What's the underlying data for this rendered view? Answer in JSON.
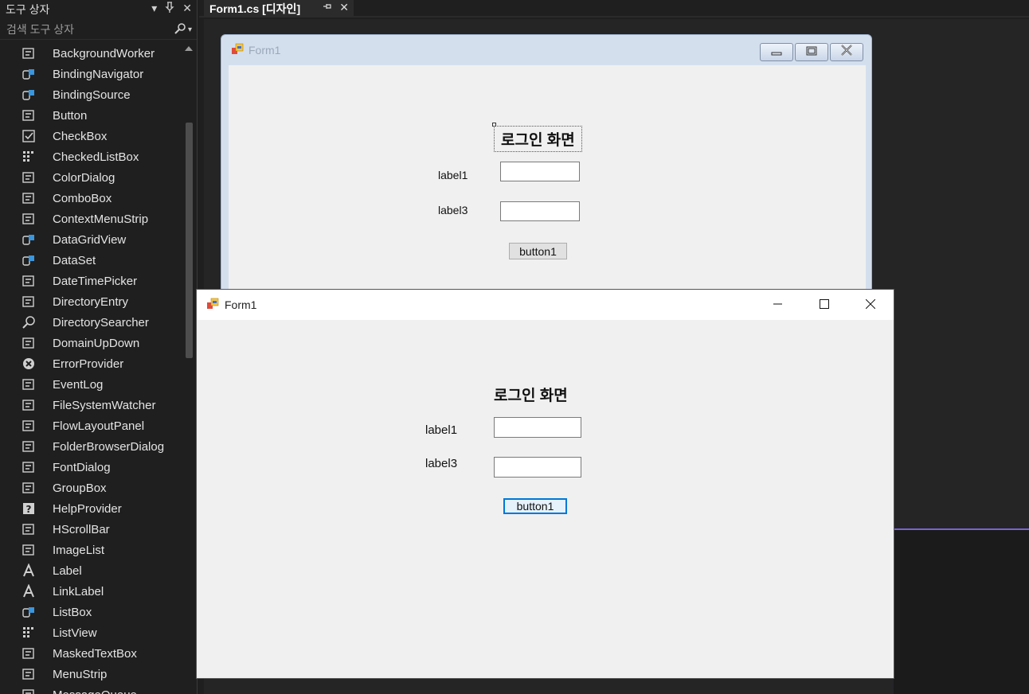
{
  "toolbox": {
    "title": "도구 상자",
    "search_placeholder": "검색 도구 상자",
    "items": [
      {
        "label": "BackgroundWorker",
        "icon": "background-worker-icon"
      },
      {
        "label": "BindingNavigator",
        "icon": "binding-navigator-icon"
      },
      {
        "label": "BindingSource",
        "icon": "binding-source-icon"
      },
      {
        "label": "Button",
        "icon": "button-icon"
      },
      {
        "label": "CheckBox",
        "icon": "checkbox-icon"
      },
      {
        "label": "CheckedListBox",
        "icon": "checked-listbox-icon"
      },
      {
        "label": "ColorDialog",
        "icon": "color-dialog-icon"
      },
      {
        "label": "ComboBox",
        "icon": "combobox-icon"
      },
      {
        "label": "ContextMenuStrip",
        "icon": "context-menu-icon"
      },
      {
        "label": "DataGridView",
        "icon": "datagrid-icon"
      },
      {
        "label": "DataSet",
        "icon": "dataset-icon"
      },
      {
        "label": "DateTimePicker",
        "icon": "datetime-picker-icon"
      },
      {
        "label": "DirectoryEntry",
        "icon": "directory-entry-icon"
      },
      {
        "label": "DirectorySearcher",
        "icon": "directory-searcher-icon"
      },
      {
        "label": "DomainUpDown",
        "icon": "domain-updown-icon"
      },
      {
        "label": "ErrorProvider",
        "icon": "error-provider-icon"
      },
      {
        "label": "EventLog",
        "icon": "eventlog-icon"
      },
      {
        "label": "FileSystemWatcher",
        "icon": "filesystem-watcher-icon"
      },
      {
        "label": "FlowLayoutPanel",
        "icon": "flow-layout-icon"
      },
      {
        "label": "FolderBrowserDialog",
        "icon": "folder-browser-icon"
      },
      {
        "label": "FontDialog",
        "icon": "font-dialog-icon"
      },
      {
        "label": "GroupBox",
        "icon": "groupbox-icon"
      },
      {
        "label": "HelpProvider",
        "icon": "help-provider-icon"
      },
      {
        "label": "HScrollBar",
        "icon": "hscrollbar-icon"
      },
      {
        "label": "ImageList",
        "icon": "imagelist-icon"
      },
      {
        "label": "Label",
        "icon": "label-icon"
      },
      {
        "label": "LinkLabel",
        "icon": "linklabel-icon"
      },
      {
        "label": "ListBox",
        "icon": "listbox-icon"
      },
      {
        "label": "ListView",
        "icon": "listview-icon"
      },
      {
        "label": "MaskedTextBox",
        "icon": "masked-textbox-icon"
      },
      {
        "label": "MenuStrip",
        "icon": "menustrip-icon"
      },
      {
        "label": "MessageQueue",
        "icon": "message-queue-icon"
      }
    ]
  },
  "document_tab": {
    "label": "Form1.cs [디자인]"
  },
  "designer_form": {
    "title": "Form1",
    "heading": "로그인 화면",
    "label1": "label1",
    "label3": "label3",
    "button": "button1"
  },
  "runtime_form": {
    "title": "Form1",
    "heading": "로그인 화면",
    "label1": "label1",
    "label3": "label3",
    "button": "button1"
  },
  "colors": {
    "ide_background": "#1f1f1f",
    "form_background": "#f0f0f0",
    "accent_focus": "#0078d7",
    "panel_accent": "#7b63d6"
  }
}
